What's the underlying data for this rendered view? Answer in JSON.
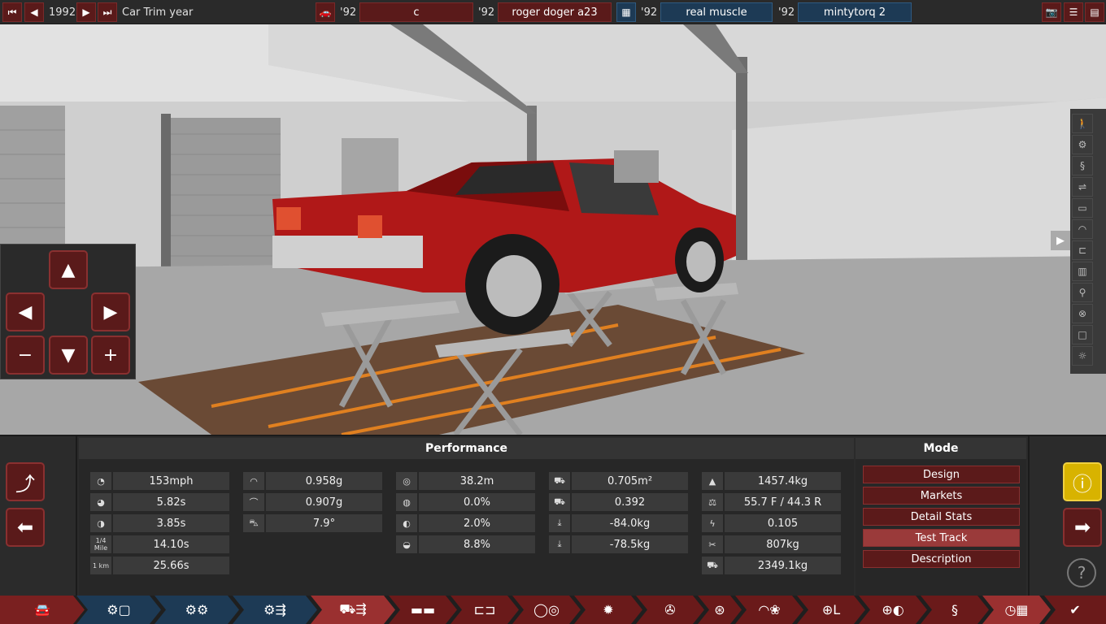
{
  "topbar": {
    "year": "1992",
    "mode_label": "Car Trim year",
    "slots": [
      {
        "year": "'92",
        "name": "c"
      },
      {
        "year": "'92",
        "name": "roger doger a23"
      },
      {
        "year": "'92",
        "name": "real muscle"
      },
      {
        "year": "'92",
        "name": "mintytorq 2"
      }
    ]
  },
  "performance": {
    "title": "Performance",
    "col1": [
      "153mph",
      "5.82s",
      "3.85s",
      "14.10s",
      "25.66s"
    ],
    "col1_icons": [
      "",
      "",
      "",
      "1/4 Mile",
      "1 km"
    ],
    "col2": [
      "0.958g",
      "0.907g",
      "7.9°"
    ],
    "col3": [
      "38.2m",
      "0.0%",
      "2.0%",
      "8.8%"
    ],
    "col4": [
      "0.705m²",
      "0.392",
      "-84.0kg",
      "-78.5kg"
    ],
    "col5": [
      "1457.4kg",
      "55.7 F / 44.3 R",
      "0.105",
      "807kg",
      "2349.1kg"
    ]
  },
  "mode": {
    "title": "Mode",
    "items": [
      "Design",
      "Markets",
      "Detail Stats",
      "Test Track",
      "Description"
    ],
    "active": "Test Track"
  },
  "colors": {
    "accent": "#5a1a1a",
    "active_tab": "#9a3a3a",
    "blue_tab": "#1d3a55",
    "warning": "#d8b300"
  }
}
